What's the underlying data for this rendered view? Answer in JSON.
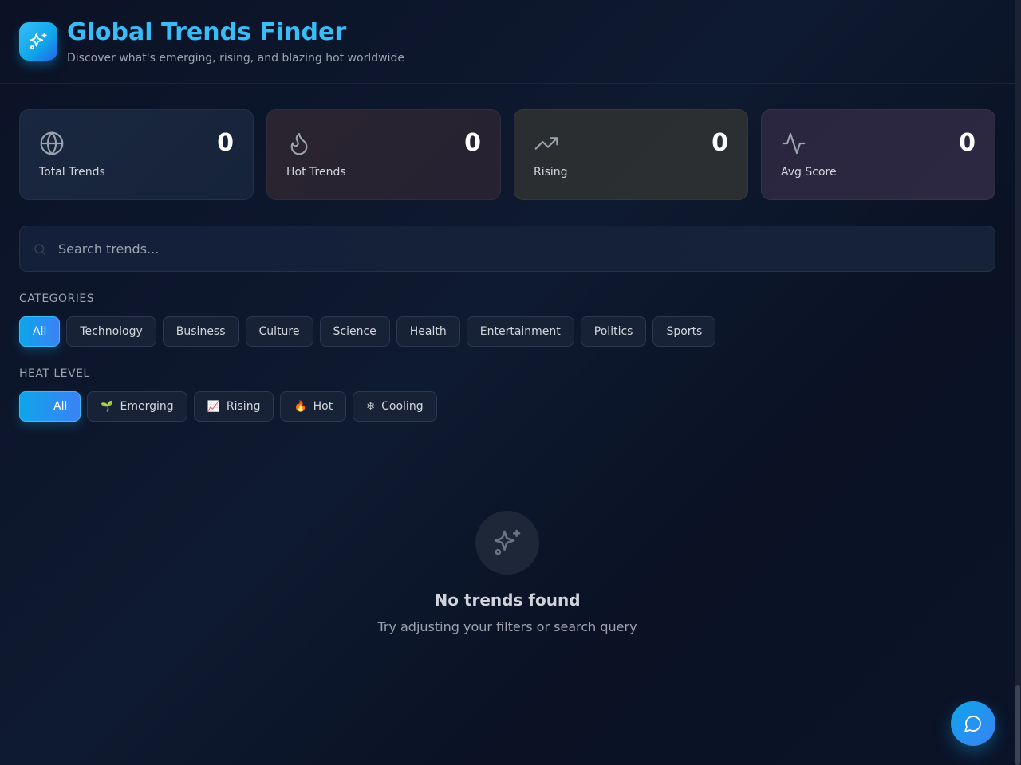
{
  "header": {
    "title": "Global Trends Finder",
    "subtitle": "Discover what's emerging, rising, and blazing hot worldwide",
    "logo_icon": "sparkles-icon"
  },
  "stats": [
    {
      "label": "Total Trends",
      "value": "0",
      "icon": "globe-icon"
    },
    {
      "label": "Hot Trends",
      "value": "0",
      "icon": "flame-icon"
    },
    {
      "label": "Rising",
      "value": "0",
      "icon": "trending-up-icon"
    },
    {
      "label": "Avg Score",
      "value": "0",
      "icon": "activity-icon"
    }
  ],
  "search": {
    "placeholder": "Search trends...",
    "value": ""
  },
  "categories": {
    "label": "CATEGORIES",
    "items": [
      "All",
      "Technology",
      "Business",
      "Culture",
      "Science",
      "Health",
      "Entertainment",
      "Politics",
      "Sports"
    ],
    "selected": "All"
  },
  "heat_level": {
    "label": "HEAT LEVEL",
    "items": [
      {
        "emoji": "",
        "label": "All"
      },
      {
        "emoji": "🌱",
        "label": "Emerging"
      },
      {
        "emoji": "📈",
        "label": "Rising"
      },
      {
        "emoji": "🔥",
        "label": "Hot"
      },
      {
        "emoji": "❄",
        "label": "Cooling"
      }
    ],
    "selected": "All"
  },
  "empty_state": {
    "title": "No trends found",
    "message": "Try adjusting your filters or search query",
    "icon": "sparkles-icon"
  },
  "chat_button": {
    "icon": "chat-bubble-icon"
  },
  "colors": {
    "accent": "#0ea5e9",
    "title": "#38bdf8",
    "background": "#0b1226"
  }
}
